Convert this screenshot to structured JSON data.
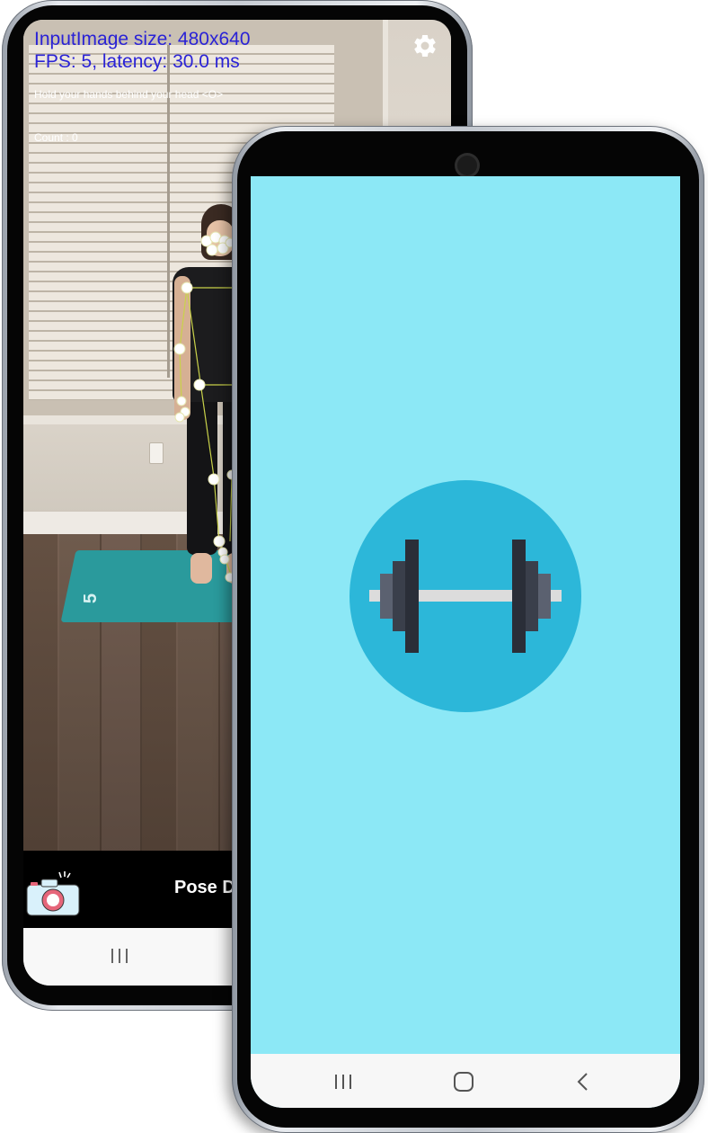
{
  "back_phone": {
    "overlay": {
      "image_size_text": "InputImage size: 480x640",
      "fps_text": "FPS: 5, latency: 30.0 ms",
      "instruction_text": "Hold your hands behind your head <O>",
      "count_text": "Count : 0"
    },
    "settings_icon": "gear-icon",
    "bottom_bar": {
      "camera_icon": "camera-icon",
      "title": "Pose D"
    },
    "nav": {
      "recents_icon": "recents-icon",
      "home_icon": "home-icon"
    },
    "colors": {
      "overlay_text": "#2a22d6",
      "bottom_bar": "#000000"
    }
  },
  "front_phone": {
    "splash": {
      "logo_icon": "dumbbell-icon",
      "background": "#8ce8f6",
      "circle": "#2cb7d9"
    },
    "nav": {
      "recents_icon": "recents-icon",
      "home_icon": "home-icon",
      "back_icon": "back-icon"
    }
  }
}
